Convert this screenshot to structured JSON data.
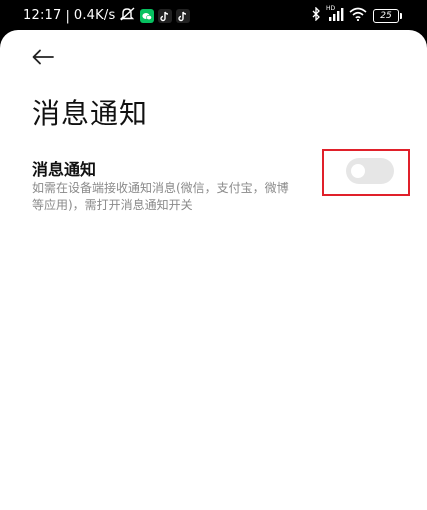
{
  "status_bar": {
    "time": "12:17",
    "network_speed": "0.4K/s",
    "battery": "25",
    "signal_label": "HD"
  },
  "page": {
    "title": "消息通知"
  },
  "setting": {
    "title": "消息通知",
    "description": "如需在设备端接收通知消息(微信，支付宝，微博等应用)，需打开消息通知开关",
    "toggle_on": false
  },
  "colors": {
    "highlight": "#e0202a",
    "toggle_off": "#e6e6e6"
  }
}
